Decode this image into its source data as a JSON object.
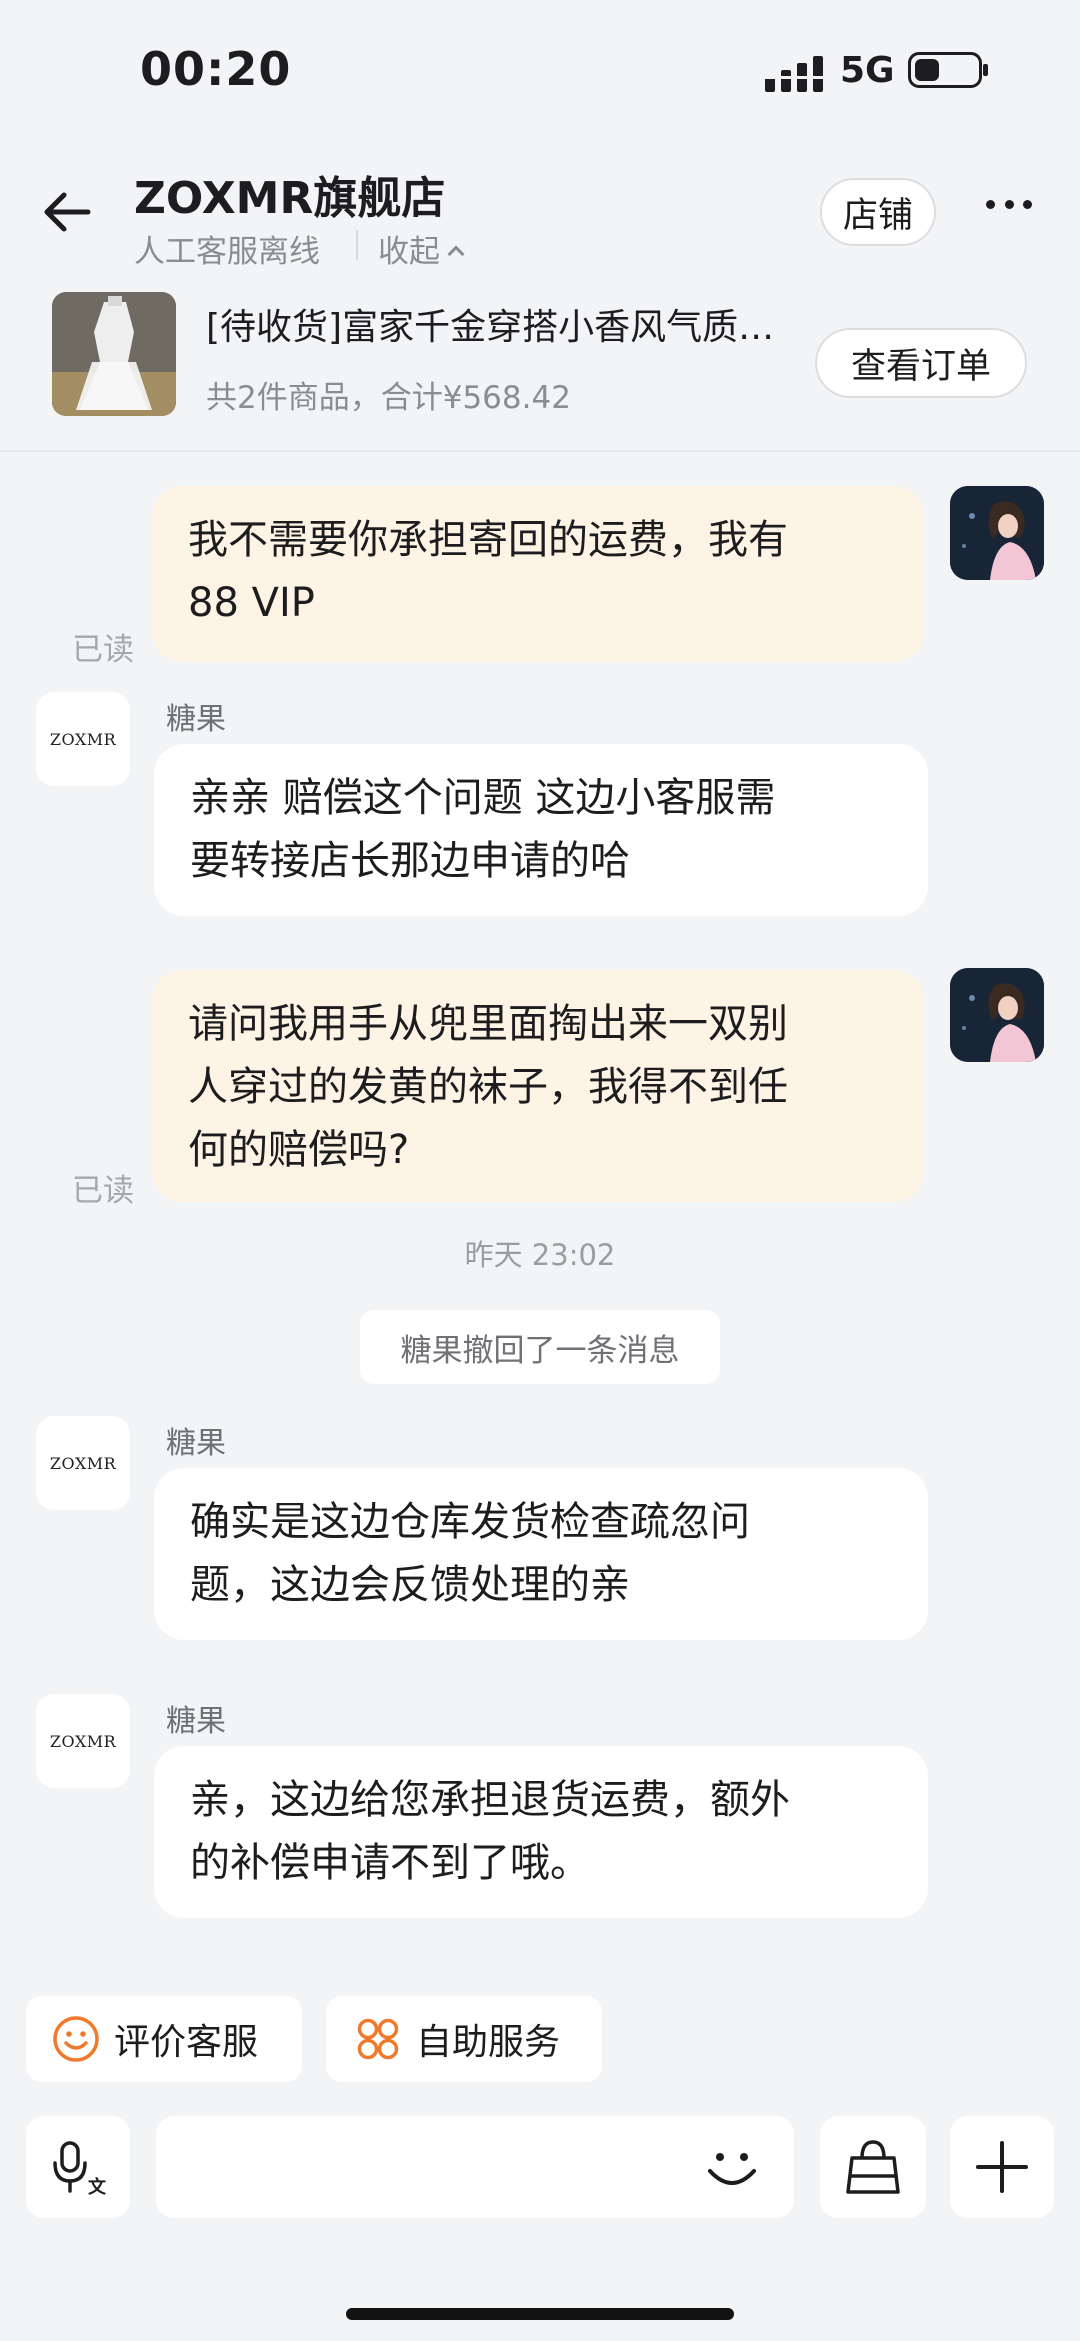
{
  "status_bar": {
    "time": "00:20",
    "network": "5G"
  },
  "header": {
    "shop_name": "ZOXMR旗舰店",
    "service_status": "人工客服离线",
    "collapse_label": "收起",
    "store_button": "店铺"
  },
  "order": {
    "title": "[待收货]富家千金穿搭小香风气质套装裙",
    "summary": "共2件商品，合计¥568.42",
    "view_button": "查看订单"
  },
  "shop_logo_text": "ZOXMR",
  "messages": [
    {
      "side": "me",
      "text_lines": [
        "我不需要你承担寄回的运费，我有",
        "88 VIP"
      ],
      "read_label": "已读"
    },
    {
      "side": "them",
      "sender": "糖果",
      "text_lines": [
        "亲亲 赔偿这个问题  这边小客服需",
        "要转接店长那边申请的哈"
      ]
    },
    {
      "side": "me",
      "text_lines": [
        "请问我用手从兜里面掏出来一双别",
        "人穿过的发黄的袜子，我得不到任",
        "何的赔偿吗?"
      ],
      "read_label": "已读"
    },
    {
      "timestamp": "昨天 23:02"
    },
    {
      "notice": "糖果撤回了一条消息"
    },
    {
      "side": "them",
      "sender": "糖果",
      "text_lines": [
        "确实是这边仓库发货检查疏忽问",
        "题，这边会反馈处理的亲"
      ]
    },
    {
      "side": "them",
      "sender": "糖果",
      "text_lines": [
        "亲，这边给您承担退货运费，额外",
        "的补偿申请不到了哦。"
      ]
    }
  ],
  "quick_actions": [
    {
      "label": "评价客服",
      "icon": "smiley-rate-icon"
    },
    {
      "label": "自助服务",
      "icon": "self-service-grid-icon"
    }
  ],
  "input_bar": {
    "voice_icon": "voice-translate-icon",
    "emoji_icon": "emoji-icon",
    "goods_icon": "shopping-bag-icon",
    "more_icon": "plus-icon"
  },
  "colors": {
    "background": "#f3f4f6",
    "my_bubble": "#fdf4e6",
    "their_bubble": "#ffffff",
    "accent_orange": "#f07a2b",
    "muted_text": "#8a8d93"
  }
}
